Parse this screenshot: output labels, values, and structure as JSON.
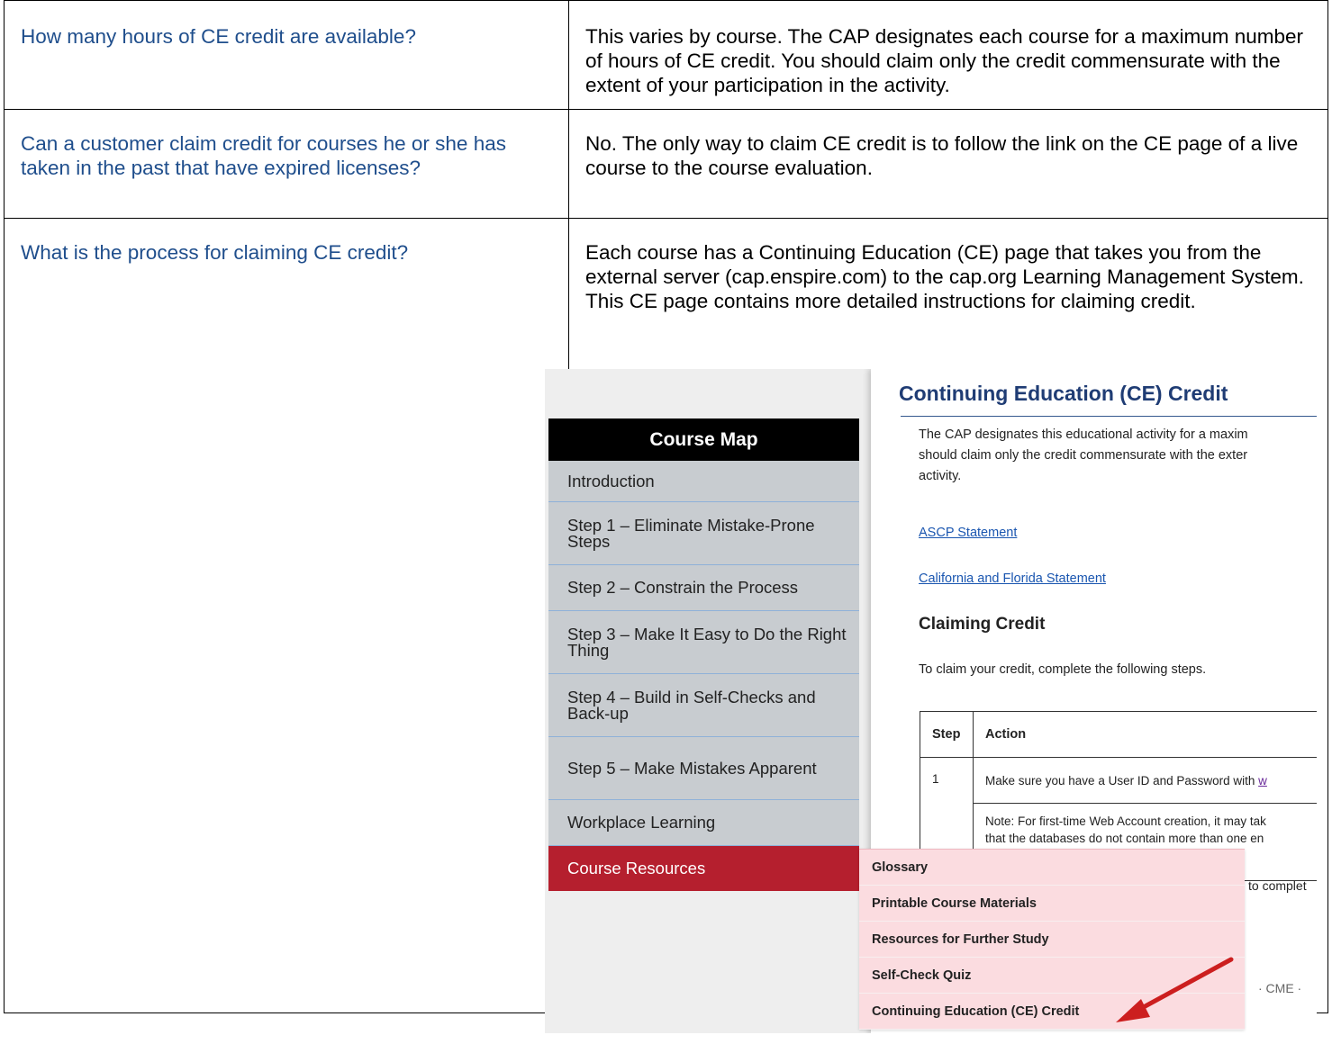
{
  "faq": [
    {
      "question": "How many hours of CE credit are available?",
      "answer": "This varies by course. The CAP designates each course for a maximum number of hours of CE credit. You should claim only the credit commensurate with the extent of your participation in the activity."
    },
    {
      "question": "Can a customer claim credit for courses he or she has taken in the past that have expired licenses?",
      "answer": "No. The only way to claim CE credit is to follow the link on the CE page of a live course to the course evaluation."
    },
    {
      "question": "What is the process for claiming CE credit?",
      "answer": "Each course has a Continuing Education (CE) page that takes you from the external server (cap.enspire.com) to the cap.org Learning Management System. This CE page contains more detailed instructions for claiming credit."
    }
  ],
  "screenshot": {
    "course_map": {
      "title": "Course Map",
      "items": [
        {
          "label": "Introduction"
        },
        {
          "label": "Step 1 – Eliminate Mistake-Prone Steps"
        },
        {
          "label": "Step 2 – Constrain the Process"
        },
        {
          "label": "Step 3 – Make It Easy to Do the Right Thing"
        },
        {
          "label": "Step 4 – Build in Self-Checks and Back-up"
        },
        {
          "label": "Step 5 – Make Mistakes Apparent"
        },
        {
          "label": "Workplace Learning"
        },
        {
          "label": "Course Resources"
        }
      ]
    },
    "ce_page": {
      "title": "Continuing Education (CE) Credit",
      "intro_lines": [
        "The CAP designates this educational activity for a maxim",
        "should claim only the credit commensurate with the exter",
        "activity."
      ],
      "link_ascp": "ASCP Statement",
      "link_cafl": "California and Florida Statement",
      "heading": "Claiming Credit",
      "steps_intro": "To claim your credit, complete the following steps.",
      "table_headers": {
        "step": "Step",
        "action": "Action"
      },
      "row1_step": "1",
      "row1_action": "Make sure you have a User ID and Password with ",
      "row1_link": "w",
      "note_line1": "Note: For first-time Web Account creation, it may tak",
      "note_line2": "that the databases do not contain more than one en",
      "fragment_complete": "to complet",
      "fragment_bottom": "· CME ·"
    },
    "resources_menu": [
      {
        "label": "Glossary"
      },
      {
        "label": "Printable Course Materials"
      },
      {
        "label": "Resources for Further Study"
      },
      {
        "label": "Self-Check Quiz"
      },
      {
        "label": "Continuing Education (CE) Credit"
      }
    ],
    "colors": {
      "arrow": "#cc1f1f",
      "active_item": "#b51f2e",
      "menu_bg": "#fbdce0"
    }
  }
}
